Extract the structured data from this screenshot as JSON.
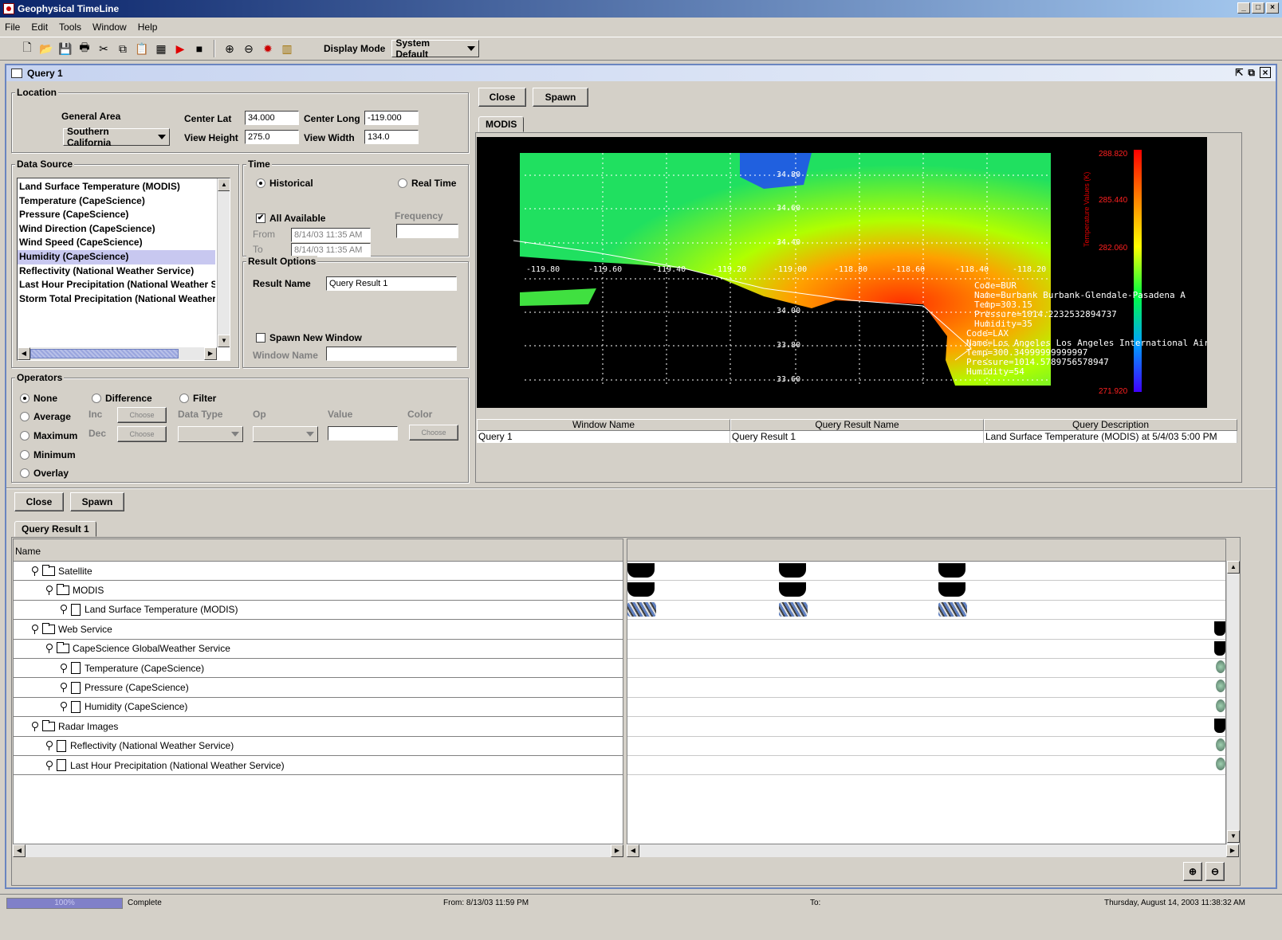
{
  "app": {
    "title": "Geophysical TimeLine"
  },
  "menu": [
    "File",
    "Edit",
    "Tools",
    "Window",
    "Help"
  ],
  "toolbar": {
    "display_mode_label": "Display Mode",
    "display_mode_value": "System Default"
  },
  "window": {
    "title": "Query 1"
  },
  "location": {
    "legend": "Location",
    "general_area_label": "General Area",
    "general_area_value": "Southern California",
    "center_lat_label": "Center Lat",
    "center_lat": "34.000",
    "center_long_label": "Center Long",
    "center_long": "-119.000",
    "view_height_label": "View Height",
    "view_height": "275.0",
    "view_width_label": "View Width",
    "view_width": "134.0"
  },
  "data_source": {
    "legend": "Data Source",
    "items": [
      "Land Surface Temperature (MODIS)",
      "Temperature (CapeScience)",
      "Pressure (CapeScience)",
      "Wind Direction (CapeScience)",
      "Wind Speed (CapeScience)",
      "Humidity (CapeScience)",
      "Reflectivity (National Weather Service)",
      "Last Hour Precipitation (National Weather Ser",
      "Storm Total Precipitation (National Weather S"
    ],
    "selected_index": 5
  },
  "time": {
    "legend": "Time",
    "historical": "Historical",
    "real_time": "Real Time",
    "all_available": "All Available",
    "frequency": "Frequency",
    "from_label": "From",
    "from_value": "8/14/03 11:35 AM",
    "to_label": "To",
    "to_value": "8/14/03 11:35 AM"
  },
  "result_options": {
    "legend": "Result Options",
    "result_name_label": "Result Name",
    "result_name": "Query Result 1",
    "spawn_new_window": "Spawn New Window",
    "window_name_label": "Window Name"
  },
  "operators": {
    "legend": "Operators",
    "none": "None",
    "difference": "Difference",
    "filter": "Filter",
    "average": "Average",
    "maximum": "Maximum",
    "minimum": "Minimum",
    "overlay": "Overlay",
    "inc": "Inc",
    "dec": "Dec",
    "choose": "Choose",
    "data_type": "Data Type",
    "op": "Op",
    "value": "Value",
    "color": "Color"
  },
  "right_panel": {
    "close": "Close",
    "spawn": "Spawn",
    "tab": "MODIS",
    "map": {
      "lat_labels": [
        "34.80",
        "34.60",
        "34.40",
        "34.00",
        "33.80",
        "33.60"
      ],
      "lon_labels": [
        "-119.80",
        "-119.60",
        "-119.40",
        "-119.20",
        "-119.00",
        "-118.80",
        "-118.60",
        "-118.40",
        "-118.20"
      ],
      "colorbar_labels": [
        "288.820",
        "285.440",
        "282.060",
        "271.920"
      ],
      "colorbar_title": "Temperature Values (K)",
      "annotations": [
        "Code=BUR",
        "Name=Burbank  Burbank-Glendale-Pasadena A",
        "Temp=303.15",
        "Pressure=1014.2232532894737",
        "Humidity=35",
        "Code=LAX",
        "Name=Los Angeles  Los Angeles International Air",
        "Temp=300.34999999999997",
        "Pressure=1014.5789756578947",
        "Humidity=54"
      ]
    },
    "table": {
      "headers": [
        "Window Name",
        "Query Result Name",
        "Query Description"
      ],
      "row": [
        "Query 1",
        "Query Result 1",
        "Land Surface Temperature (MODIS) at 5/4/03 5:00 PM"
      ]
    }
  },
  "bottom": {
    "close": "Close",
    "spawn": "Spawn",
    "tab": "Query Result 1",
    "name_header": "Name",
    "tree": [
      {
        "label": "Satellite",
        "level": 0,
        "type": "folder"
      },
      {
        "label": "MODIS",
        "level": 1,
        "type": "folder"
      },
      {
        "label": "Land Surface Temperature (MODIS)",
        "level": 2,
        "type": "doc"
      },
      {
        "label": "Web Service",
        "level": 0,
        "type": "folder"
      },
      {
        "label": "CapeScience GlobalWeather Service",
        "level": 1,
        "type": "folder"
      },
      {
        "label": "Temperature (CapeScience)",
        "level": 2,
        "type": "doc"
      },
      {
        "label": "Pressure (CapeScience)",
        "level": 2,
        "type": "doc"
      },
      {
        "label": "Humidity (CapeScience)",
        "level": 2,
        "type": "doc"
      },
      {
        "label": "Radar Images",
        "level": 0,
        "type": "folder"
      },
      {
        "label": "Reflectivity (National Weather Service)",
        "level": 1,
        "type": "doc"
      },
      {
        "label": "Last Hour Precipitation (National Weather Service)",
        "level": 1,
        "type": "doc"
      }
    ]
  },
  "status": {
    "progress_text": "100%",
    "progress": 1.0,
    "state": "Complete",
    "from": "From:    8/13/03 11:59 PM",
    "to": "To:",
    "datetime": "Thursday, August 14, 2003 11:38:32 AM"
  }
}
